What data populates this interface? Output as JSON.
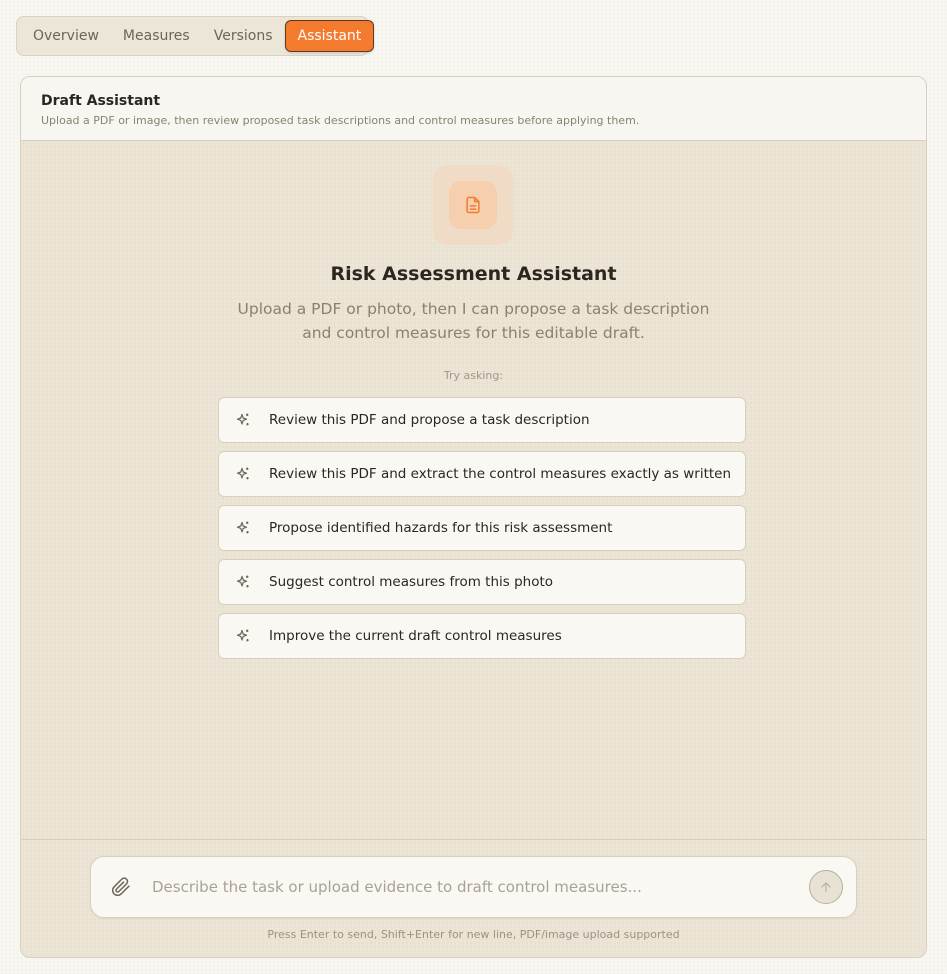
{
  "tabs": [
    {
      "label": "Overview"
    },
    {
      "label": "Measures"
    },
    {
      "label": "Versions"
    },
    {
      "label": "Assistant",
      "active": true
    }
  ],
  "panel": {
    "title": "Draft Assistant",
    "subtitle": "Upload a PDF or image, then review proposed task descriptions and control measures before applying them."
  },
  "assistant": {
    "icon": "document-icon",
    "title": "Risk Assessment Assistant",
    "description": "Upload a PDF or photo, then I can propose a task description and control measures for this editable draft.",
    "try_label": "Try asking:",
    "suggestions": [
      {
        "label": "Review this PDF and propose a task description",
        "icon": "sparkle-icon"
      },
      {
        "label": "Review this PDF and extract the control measures exactly as written",
        "icon": "sparkle-icon"
      },
      {
        "label": "Propose identified hazards for this risk assessment",
        "icon": "sparkle-icon"
      },
      {
        "label": "Suggest control measures from this photo",
        "icon": "sparkle-icon"
      },
      {
        "label": "Improve the current draft control measures",
        "icon": "sparkle-icon"
      }
    ]
  },
  "composer": {
    "placeholder": "Describe the task or upload evidence to draft control measures...",
    "value": "",
    "attach_icon": "paperclip-icon",
    "send_icon": "arrow-up-icon",
    "hint": "Press Enter to send, Shift+Enter for new line, PDF/image upload supported"
  },
  "colors": {
    "accent": "#f47b2d",
    "background": "#f8f6f0",
    "panel_background": "#ece5d6",
    "border": "#d8d0bf"
  }
}
